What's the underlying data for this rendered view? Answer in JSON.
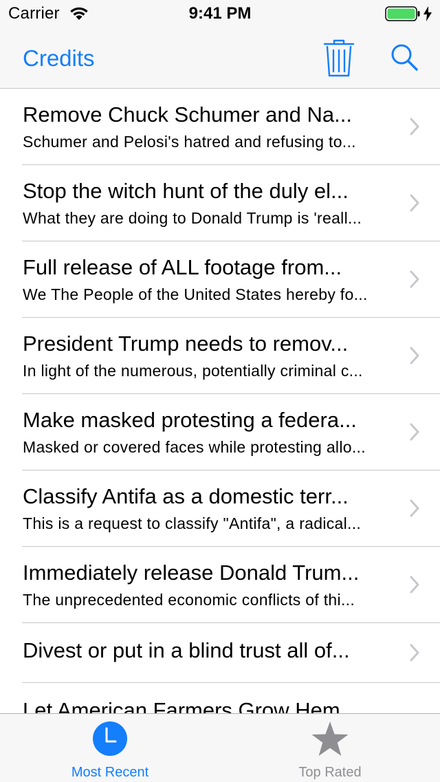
{
  "status_bar": {
    "carrier": "Carrier",
    "time": "9:41 PM",
    "battery_color": "#4cd964"
  },
  "nav": {
    "title": "Credits",
    "accent_color": "#147efb",
    "trash_icon": "trash-icon",
    "search_icon": "search-icon"
  },
  "petitions": [
    {
      "title": "Remove Chuck Schumer and Na...",
      "subtitle": "Schumer and Pelosi's hatred and refusing to..."
    },
    {
      "title": "Stop the witch hunt of the duly el...",
      "subtitle": "What they are doing to Donald Trump is 'reall..."
    },
    {
      "title": "Full release of ALL footage from...",
      "subtitle": "We The People of the United States hereby fo..."
    },
    {
      "title": "President Trump needs to remov...",
      "subtitle": "In light of the numerous, potentially criminal c..."
    },
    {
      "title": "Make masked protesting a federa...",
      "subtitle": "Masked or covered faces while protesting allo..."
    },
    {
      "title": "Classify Antifa as a domestic terr...",
      "subtitle": "This is a request to classify \"Antifa\", a radical..."
    },
    {
      "title": "Immediately release Donald Trum...",
      "subtitle": "The unprecedented economic conflicts of thi..."
    },
    {
      "title": "Divest or put in a blind trust all of...",
      "subtitle": ""
    },
    {
      "title": "Let American Farmers Grow Hem...",
      "subtitle": ""
    }
  ],
  "tabs": [
    {
      "label": "Most Recent",
      "icon": "clock-icon",
      "selected": true,
      "color": "#147efb"
    },
    {
      "label": "Top Rated",
      "icon": "star-icon",
      "selected": false,
      "color": "#8e8e93"
    }
  ]
}
